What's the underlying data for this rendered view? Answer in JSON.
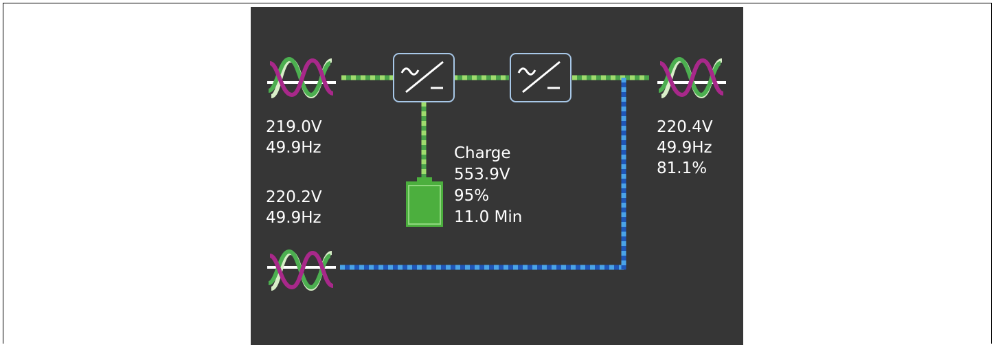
{
  "colors": {
    "panel_background": "#363636",
    "online_path_green": "#4aa34a",
    "online_path_light": "#9fdc6e",
    "bypass_path_blue": "#1f56b8",
    "bypass_path_light": "#4aa3e8",
    "battery_green": "#4caf3e",
    "converter_border": "#a8c8e8",
    "wave_purple": "#a8288a",
    "wave_green": "#4caf50",
    "wave_light": "#d8eec8"
  },
  "icons": {
    "main_input": "ac-sine-wave-icon",
    "bypass_input": "ac-sine-wave-icon",
    "output": "ac-sine-wave-icon",
    "rectifier": "ac-dc-converter-icon",
    "inverter": "dc-ac-converter-icon",
    "battery": "battery-icon"
  },
  "main_input": {
    "voltage": "219.0V",
    "frequency": "49.9Hz"
  },
  "bypass_input": {
    "voltage": "220.2V",
    "frequency": "49.9Hz"
  },
  "battery": {
    "status": "Charge",
    "voltage": "553.9V",
    "capacity": "95%",
    "runtime": "11.0 Min"
  },
  "output": {
    "voltage": "220.4V",
    "frequency": "49.9Hz",
    "load": "81.1%"
  }
}
